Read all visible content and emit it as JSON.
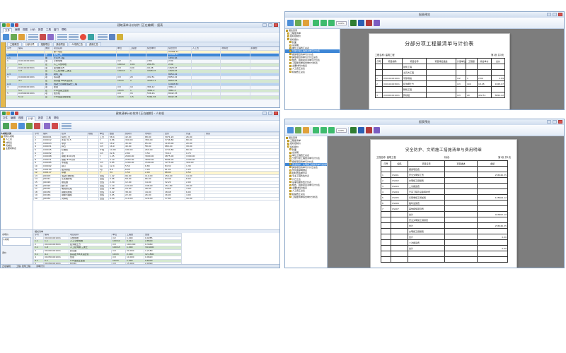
{
  "left_top_window": {
    "title": "建筑清单计价软件 [正在编辑] - 报表",
    "menus": [
      "文件",
      "编辑",
      "视图",
      "计价",
      "报表",
      "工具",
      "窗口",
      "帮助"
    ],
    "tabs": [
      "工程概况",
      "分部分项",
      "措施项目",
      "其他项目",
      "人材机汇总",
      "费用汇总"
    ],
    "columns": [
      "序号",
      "编码",
      "类别",
      "项目名称",
      "单位",
      "工程量",
      "综合单价",
      "综合合价",
      "人工费",
      "材料费",
      "机械费"
    ],
    "rows": [
      {
        "no": "",
        "code": "",
        "type": "",
        "name": "整个项目",
        "unit": "",
        "qty": "",
        "price": "",
        "total": "22384.71",
        "style": "hl-yellow"
      },
      {
        "no": "A",
        "code": "",
        "type": "部",
        "name": "建筑工程",
        "unit": "",
        "qty": "",
        "price": "",
        "total": "22384.71",
        "style": "hl-sel"
      },
      {
        "no": "A.1",
        "code": "",
        "type": "部",
        "name": "土石方工程",
        "unit": "",
        "qty": "",
        "price": "",
        "total": "1830.96",
        "style": "hl-blue"
      },
      {
        "no": "1",
        "code": "010101001001",
        "type": "项",
        "name": "平整场地",
        "unit": "m2",
        "qty": "1",
        "price": "2.89",
        "total": "2.89",
        "style": ""
      },
      {
        "no": "",
        "code": "1-1",
        "type": "定",
        "name": "人工平整场地",
        "unit": "100m2",
        "qty": "0.01",
        "price": "289.35",
        "total": "2.89",
        "style": "hl-green"
      },
      {
        "no": "2",
        "code": "010101003001",
        "type": "项",
        "name": "挖沟槽土方",
        "unit": "m3",
        "qty": "100",
        "price": "18.28",
        "total": "1828.07",
        "style": ""
      },
      {
        "no": "",
        "code": "1-8",
        "type": "定",
        "name": "人工挖沟槽 三类土",
        "unit": "100m3",
        "qty": "1",
        "price": "1828.07",
        "total": "1828.07",
        "style": "hl-green"
      },
      {
        "no": "A.3",
        "code": "",
        "type": "部",
        "name": "砌筑工程",
        "unit": "",
        "qty": "",
        "price": "",
        "total": "8650.22",
        "style": "hl-blue"
      },
      {
        "no": "3",
        "code": "010401001001",
        "type": "项",
        "name": "砖基础",
        "unit": "m3",
        "qty": "20",
        "price": "432.51",
        "total": "8650.22",
        "style": ""
      },
      {
        "no": "",
        "code": "4-1",
        "type": "定",
        "name": "砖基础 M5水泥砂浆",
        "unit": "10m3",
        "qty": "2",
        "price": "4325.11",
        "total": "8650.22",
        "style": "hl-green"
      },
      {
        "no": "A.4",
        "code": "",
        "type": "部",
        "name": "混凝土及钢筋混凝土工程",
        "unit": "",
        "qty": "",
        "price": "",
        "total": "11903.53",
        "style": "hl-blue"
      },
      {
        "no": "4",
        "code": "010501001001",
        "type": "项",
        "name": "垫层",
        "unit": "m3",
        "qty": "10",
        "price": "386.12",
        "total": "3861.2",
        "style": ""
      },
      {
        "no": "",
        "code": "5-1",
        "type": "定",
        "name": "C15混凝土垫层",
        "unit": "10m3",
        "qty": "1",
        "price": "3861.2",
        "total": "3861.2",
        "style": "hl-green"
      },
      {
        "no": "5",
        "code": "010502001001",
        "type": "项",
        "name": "矩形柱",
        "unit": "m3",
        "qty": "15",
        "price": "536.16",
        "total": "8042.33",
        "style": ""
      },
      {
        "no": "",
        "code": "5-12",
        "type": "定",
        "name": "C30混凝土矩形柱",
        "unit": "10m3",
        "qty": "1.5",
        "price": "5361.55",
        "total": "8042.33",
        "style": "hl-green"
      }
    ]
  },
  "left_bottom_window": {
    "title": "建筑清单计价软件 [正在编辑] - 人材机",
    "menus": [
      "文件",
      "编辑",
      "视图",
      "计价",
      "报表",
      "工具",
      "帮助"
    ],
    "tree_title": "人材机分类",
    "tree": [
      "所有人材机",
      "人工表",
      "材料表",
      "机械表",
      "主要材料表"
    ],
    "columns": [
      "序号",
      "编码",
      "名称",
      "规格",
      "单位",
      "数量",
      "预算价",
      "市场价",
      "合价",
      "价差",
      "供货"
    ],
    "rows": [
      {
        "no": "1",
        "code": "R00001",
        "name": "综合工日",
        "unit": "工日",
        "qty": "58.4",
        "p1": "42.00",
        "p2": "68.00",
        "sum": "3971.20",
        "diff": "26.00"
      },
      {
        "no": "2",
        "code": "C00012",
        "name": "水泥 32.5",
        "unit": "t",
        "qty": "9.86",
        "p1": "300.00",
        "p2": "380.00",
        "sum": "3746.80",
        "diff": "80.00"
      },
      {
        "no": "3",
        "code": "C00023",
        "name": "中砂",
        "unit": "m3",
        "qty": "18.2",
        "p1": "45.00",
        "p2": "65.00",
        "sum": "1183.00",
        "diff": "20.00"
      },
      {
        "no": "4",
        "code": "C00031",
        "name": "碎石",
        "unit": "m3",
        "qty": "16.9",
        "p1": "40.00",
        "p2": "58.00",
        "sum": "980.20",
        "diff": "18.00"
      },
      {
        "no": "5",
        "code": "C00045",
        "name": "标准砖",
        "unit": "千块",
        "qty": "10.48",
        "p1": "180.00",
        "p2": "260.00",
        "sum": "2724.80",
        "diff": "80.00"
      },
      {
        "no": "6",
        "code": "C00052",
        "name": "水",
        "unit": "m3",
        "qty": "22.6",
        "p1": "2.80",
        "p2": "3.50",
        "sum": "79.10",
        "diff": "0.70"
      },
      {
        "no": "7",
        "code": "C00068",
        "name": "钢筋 Φ10以内",
        "unit": "t",
        "qty": "1.25",
        "p1": "2600.00",
        "p2": "3900.00",
        "sum": "4875.00",
        "diff": "1300.00"
      },
      {
        "no": "8",
        "code": "C00071",
        "name": "钢筋 Φ10以外",
        "unit": "t",
        "qty": "2.10",
        "p1": "2550.00",
        "p2": "3850.00",
        "sum": "8085.00",
        "diff": "1300.00"
      },
      {
        "no": "9",
        "code": "C00085",
        "name": "木模板",
        "unit": "m3",
        "qty": "0.85",
        "p1": "1200.00",
        "p2": "1500.00",
        "sum": "1275.00",
        "diff": "300.00"
      },
      {
        "no": "10",
        "code": "C00092",
        "name": "铁钉",
        "unit": "kg",
        "qty": "12.4",
        "p1": "5.50",
        "p2": "6.80",
        "sum": "84.32",
        "diff": "1.30"
      },
      {
        "no": "11",
        "code": "C00104",
        "name": "镀锌铁丝",
        "unit": "kg",
        "qty": "8.6",
        "p1": "6.00",
        "p2": "7.20",
        "sum": "61.92",
        "diff": "1.20"
      },
      {
        "no": "12",
        "code": "C00117",
        "name": "草袋",
        "unit": "个",
        "qty": "34",
        "p1": "1.50",
        "p2": "2.00",
        "sum": "68.00",
        "diff": "0.50"
      },
      {
        "no": "13",
        "code": "J00003",
        "name": "混凝土搅拌机",
        "unit": "台班",
        "qty": "1.42",
        "p1": "96.00",
        "p2": "110.00",
        "sum": "156.20",
        "diff": "14.00"
      },
      {
        "no": "14",
        "code": "J00011",
        "name": "灰浆搅拌机",
        "unit": "台班",
        "qty": "0.96",
        "p1": "58.00",
        "p2": "66.00",
        "sum": "63.36",
        "diff": "8.00"
      },
      {
        "no": "15",
        "code": "J00018",
        "name": "振捣器",
        "unit": "台班",
        "qty": "2.30",
        "p1": "12.00",
        "p2": "14.00",
        "sum": "32.20",
        "diff": "2.00"
      },
      {
        "no": "16",
        "code": "J00024",
        "name": "翻斗车",
        "unit": "台班",
        "qty": "1.10",
        "p1": "120.00",
        "p2": "138.00",
        "sum": "151.80",
        "diff": "18.00"
      },
      {
        "no": "17",
        "code": "J00031",
        "name": "电动夯实机",
        "unit": "台班",
        "qty": "0.88",
        "p1": "24.00",
        "p2": "28.00",
        "sum": "24.64",
        "diff": "4.00"
      },
      {
        "no": "18",
        "code": "J00039",
        "name": "钢筋切断机",
        "unit": "台班",
        "qty": "0.42",
        "p1": "38.00",
        "p2": "44.00",
        "sum": "18.48",
        "diff": "6.00"
      },
      {
        "no": "19",
        "code": "J00046",
        "name": "钢筋弯曲机",
        "unit": "台班",
        "qty": "0.65",
        "p1": "22.00",
        "p2": "26.00",
        "sum": "16.90",
        "diff": "4.00"
      },
      {
        "no": "20",
        "code": "J00052",
        "name": "对焊机",
        "unit": "台班",
        "qty": "0.30",
        "p1": "110.00",
        "p2": "126.00",
        "sum": "37.80",
        "diff": "16.00"
      }
    ],
    "sub_panel_title": "相关清单",
    "sub_columns": [
      "序号",
      "编码",
      "项目名称",
      "单位",
      "工程量",
      "含量"
    ],
    "sub_rows": [
      {
        "no": "1",
        "code": "010101001001",
        "name": "平整场地",
        "unit": "m2",
        "qty": "1.000",
        "c": "0.0285"
      },
      {
        "no": "1.1",
        "code": "1-1",
        "name": "人工平整场地",
        "unit": "100m2",
        "qty": "0.010",
        "c": "2.8500"
      },
      {
        "no": "2",
        "code": "010101003001",
        "name": "挖沟槽土方",
        "unit": "m3",
        "qty": "100.000",
        "c": "0.3460"
      },
      {
        "no": "2.1",
        "code": "1-8",
        "name": "人工挖沟槽 三类土",
        "unit": "100m3",
        "qty": "1.000",
        "c": "34.6000"
      },
      {
        "no": "3",
        "code": "010401001001",
        "name": "砖基础",
        "unit": "m3",
        "qty": "20.000",
        "c": "1.2180"
      },
      {
        "no": "3.1",
        "code": "4-1",
        "name": "砖基础 M5水泥砂浆",
        "unit": "10m3",
        "qty": "2.000",
        "c": "12.1800"
      },
      {
        "no": "4",
        "code": "010501001001",
        "name": "垫层",
        "unit": "m3",
        "qty": "10.000",
        "c": "0.9620"
      },
      {
        "no": "4.1",
        "code": "5-1",
        "name": "C15混凝土垫层",
        "unit": "10m3",
        "qty": "1.000",
        "c": "9.6200"
      },
      {
        "no": "5",
        "code": "010502001001",
        "name": "矩形柱",
        "unit": "m3",
        "qty": "15.000",
        "c": "2.0990"
      },
      {
        "no": "5.1",
        "code": "5-12",
        "name": "C30混凝土矩形柱",
        "unit": "10m3",
        "qty": "1.500",
        "c": "20.9900"
      }
    ],
    "side_labels": [
      "市场价",
      "人材机",
      "调价"
    ],
    "buttons": [
      "确定",
      "取消"
    ],
    "status": [
      "正在编辑",
      "工程: 建筑工程",
      "清单计价"
    ]
  },
  "right_top_window": {
    "title": "报表预览",
    "zoom": "100%",
    "tree": [
      "报表目录",
      "工程量清单",
      "招标控制价",
      "投标报价",
      "封面",
      "总说明",
      "单位工程费汇总表",
      "分部分项工程量清单与计价表",
      "措施项目清单与计价表",
      "其他项目清单与计价汇总表",
      "规费、税金项目清单与计价表",
      "工程量清单综合单价分析表",
      "主要材料价格表",
      "人工费汇总表",
      "机械费汇总表"
    ],
    "report": {
      "title": "分部分项工程量清单与计价表",
      "project": "工程名称: 建筑工程",
      "page": "第1页 共3页",
      "headers": [
        "序号",
        "项目编码",
        "项目名称",
        "项目特征描述",
        "计量单位",
        "工程量",
        "综合单价",
        "合价"
      ],
      "rows": [
        [
          "",
          "",
          "建筑工程",
          "",
          "",
          "",
          "",
          ""
        ],
        [
          "",
          "",
          "土石方工程",
          "",
          "",
          "",
          "",
          ""
        ],
        [
          "1",
          "010101001001",
          "平整场地",
          "",
          "m2",
          "1",
          "2.89",
          "2.89"
        ],
        [
          "2",
          "010101003001",
          "挖沟槽土方",
          "",
          "m3",
          "100",
          "18.28",
          "1828.07"
        ],
        [
          "",
          "",
          "砌筑工程",
          "",
          "",
          "",
          "",
          ""
        ],
        [
          "3",
          "010401001001",
          "砖基础",
          "",
          "m3",
          "20",
          "432.51",
          "8650.22"
        ]
      ]
    }
  },
  "right_bottom_window": {
    "title": "报表预览",
    "zoom": "100%",
    "tree": [
      "报表目录",
      "工程量清单",
      "招标控制价",
      "投标报价",
      "封面",
      "总说明",
      "单位工程费汇总表",
      "分部分项工程量清单与计价表",
      "措施项目清单与计价表",
      "安全防护、文明施工措施清单与费用明细",
      "其他项目清单与计价汇总表",
      "暂列金额明细表",
      "材料暂估单价表",
      "专业工程暂估价表",
      "计日工表",
      "总承包服务费计价表",
      "规费、税金项目清单与计价表",
      "主要材料价格表",
      "人工费汇总表",
      "机械费汇总表",
      "工程量清单综合单价分析表"
    ],
    "report": {
      "title": "安全防护、文明施工措施清单与费用明细",
      "project": "工程名称: 建筑工程",
      "section": "标段:",
      "page": "第1页 共1页",
      "headers": [
        "序号",
        "编码",
        "项目名称",
        "项目描述",
        "金额"
      ],
      "rows": [
        [
          "",
          "",
          "措施项目费",
          "",
          ""
        ],
        [
          "1",
          "CS001",
          "安全文明施工费",
          "",
          "256340.35"
        ],
        [
          "2",
          "CS002",
          "文明施工措施费",
          "",
          ""
        ],
        [
          "3",
          "CS003",
          "二次搬运费",
          "",
          ""
        ],
        [
          "4",
          "CS004",
          "已完工程及设备保护费",
          "",
          ""
        ],
        [
          "5",
          "CS005",
          "冬雨季施工增加费",
          "",
          "125604.12"
        ],
        [
          "6",
          "CS006",
          "临时设施费",
          "",
          ""
        ],
        [
          "7",
          "CS007",
          "其他措施项目费",
          "",
          ""
        ],
        [
          "",
          "",
          "合计",
          "",
          "423657.19"
        ],
        [
          "",
          "",
          "安全文明施工措施费",
          "",
          ""
        ],
        [
          "",
          "",
          "合计",
          "",
          "256340.35"
        ],
        [
          "",
          "",
          "文明施工措施费",
          "",
          ""
        ],
        [
          "",
          "",
          "合计",
          "",
          "0.00"
        ],
        [
          "",
          "",
          "二次搬运费",
          "",
          ""
        ],
        [
          "",
          "",
          "合计",
          "",
          "0.00"
        ]
      ]
    }
  }
}
